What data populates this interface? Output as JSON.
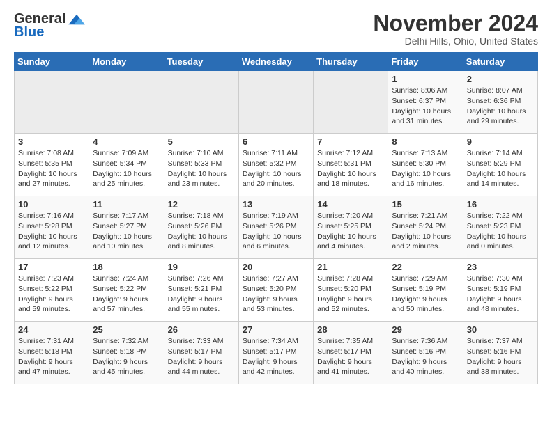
{
  "header": {
    "logo_general": "General",
    "logo_blue": "Blue",
    "month": "November 2024",
    "location": "Delhi Hills, Ohio, United States"
  },
  "weekdays": [
    "Sunday",
    "Monday",
    "Tuesday",
    "Wednesday",
    "Thursday",
    "Friday",
    "Saturday"
  ],
  "weeks": [
    [
      {
        "day": "",
        "info": ""
      },
      {
        "day": "",
        "info": ""
      },
      {
        "day": "",
        "info": ""
      },
      {
        "day": "",
        "info": ""
      },
      {
        "day": "",
        "info": ""
      },
      {
        "day": "1",
        "info": "Sunrise: 8:06 AM\nSunset: 6:37 PM\nDaylight: 10 hours\nand 31 minutes."
      },
      {
        "day": "2",
        "info": "Sunrise: 8:07 AM\nSunset: 6:36 PM\nDaylight: 10 hours\nand 29 minutes."
      }
    ],
    [
      {
        "day": "3",
        "info": "Sunrise: 7:08 AM\nSunset: 5:35 PM\nDaylight: 10 hours\nand 27 minutes."
      },
      {
        "day": "4",
        "info": "Sunrise: 7:09 AM\nSunset: 5:34 PM\nDaylight: 10 hours\nand 25 minutes."
      },
      {
        "day": "5",
        "info": "Sunrise: 7:10 AM\nSunset: 5:33 PM\nDaylight: 10 hours\nand 23 minutes."
      },
      {
        "day": "6",
        "info": "Sunrise: 7:11 AM\nSunset: 5:32 PM\nDaylight: 10 hours\nand 20 minutes."
      },
      {
        "day": "7",
        "info": "Sunrise: 7:12 AM\nSunset: 5:31 PM\nDaylight: 10 hours\nand 18 minutes."
      },
      {
        "day": "8",
        "info": "Sunrise: 7:13 AM\nSunset: 5:30 PM\nDaylight: 10 hours\nand 16 minutes."
      },
      {
        "day": "9",
        "info": "Sunrise: 7:14 AM\nSunset: 5:29 PM\nDaylight: 10 hours\nand 14 minutes."
      }
    ],
    [
      {
        "day": "10",
        "info": "Sunrise: 7:16 AM\nSunset: 5:28 PM\nDaylight: 10 hours\nand 12 minutes."
      },
      {
        "day": "11",
        "info": "Sunrise: 7:17 AM\nSunset: 5:27 PM\nDaylight: 10 hours\nand 10 minutes."
      },
      {
        "day": "12",
        "info": "Sunrise: 7:18 AM\nSunset: 5:26 PM\nDaylight: 10 hours\nand 8 minutes."
      },
      {
        "day": "13",
        "info": "Sunrise: 7:19 AM\nSunset: 5:26 PM\nDaylight: 10 hours\nand 6 minutes."
      },
      {
        "day": "14",
        "info": "Sunrise: 7:20 AM\nSunset: 5:25 PM\nDaylight: 10 hours\nand 4 minutes."
      },
      {
        "day": "15",
        "info": "Sunrise: 7:21 AM\nSunset: 5:24 PM\nDaylight: 10 hours\nand 2 minutes."
      },
      {
        "day": "16",
        "info": "Sunrise: 7:22 AM\nSunset: 5:23 PM\nDaylight: 10 hours\nand 0 minutes."
      }
    ],
    [
      {
        "day": "17",
        "info": "Sunrise: 7:23 AM\nSunset: 5:22 PM\nDaylight: 9 hours\nand 59 minutes."
      },
      {
        "day": "18",
        "info": "Sunrise: 7:24 AM\nSunset: 5:22 PM\nDaylight: 9 hours\nand 57 minutes."
      },
      {
        "day": "19",
        "info": "Sunrise: 7:26 AM\nSunset: 5:21 PM\nDaylight: 9 hours\nand 55 minutes."
      },
      {
        "day": "20",
        "info": "Sunrise: 7:27 AM\nSunset: 5:20 PM\nDaylight: 9 hours\nand 53 minutes."
      },
      {
        "day": "21",
        "info": "Sunrise: 7:28 AM\nSunset: 5:20 PM\nDaylight: 9 hours\nand 52 minutes."
      },
      {
        "day": "22",
        "info": "Sunrise: 7:29 AM\nSunset: 5:19 PM\nDaylight: 9 hours\nand 50 minutes."
      },
      {
        "day": "23",
        "info": "Sunrise: 7:30 AM\nSunset: 5:19 PM\nDaylight: 9 hours\nand 48 minutes."
      }
    ],
    [
      {
        "day": "24",
        "info": "Sunrise: 7:31 AM\nSunset: 5:18 PM\nDaylight: 9 hours\nand 47 minutes."
      },
      {
        "day": "25",
        "info": "Sunrise: 7:32 AM\nSunset: 5:18 PM\nDaylight: 9 hours\nand 45 minutes."
      },
      {
        "day": "26",
        "info": "Sunrise: 7:33 AM\nSunset: 5:17 PM\nDaylight: 9 hours\nand 44 minutes."
      },
      {
        "day": "27",
        "info": "Sunrise: 7:34 AM\nSunset: 5:17 PM\nDaylight: 9 hours\nand 42 minutes."
      },
      {
        "day": "28",
        "info": "Sunrise: 7:35 AM\nSunset: 5:17 PM\nDaylight: 9 hours\nand 41 minutes."
      },
      {
        "day": "29",
        "info": "Sunrise: 7:36 AM\nSunset: 5:16 PM\nDaylight: 9 hours\nand 40 minutes."
      },
      {
        "day": "30",
        "info": "Sunrise: 7:37 AM\nSunset: 5:16 PM\nDaylight: 9 hours\nand 38 minutes."
      }
    ]
  ]
}
